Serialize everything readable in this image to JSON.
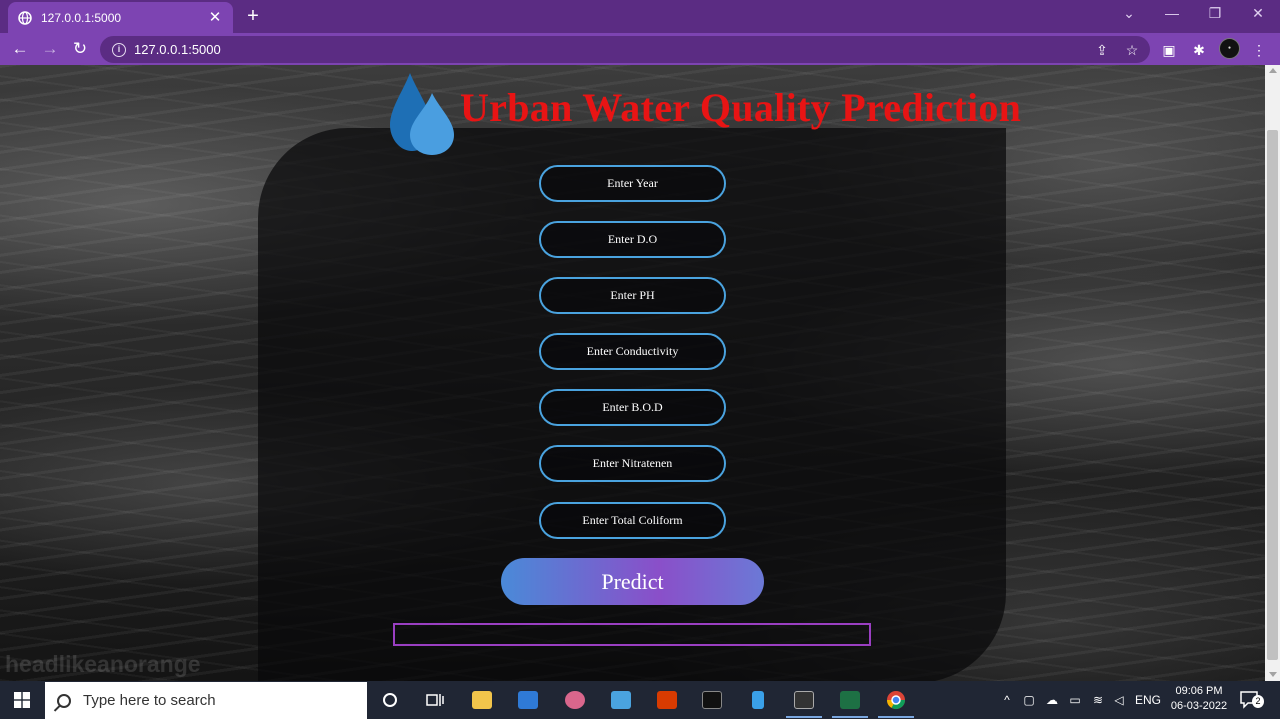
{
  "browser": {
    "tab_title": "127.0.0.1:5000",
    "tab_close": "✕",
    "new_tab": "+",
    "url": "127.0.0.1:5000"
  },
  "page": {
    "heading": "Urban Water Quality Prediction",
    "fields": [
      {
        "name": "year-input",
        "placeholder": "Enter Year"
      },
      {
        "name": "do-input",
        "placeholder": "Enter D.O"
      },
      {
        "name": "ph-input",
        "placeholder": "Enter PH"
      },
      {
        "name": "conductivity-input",
        "placeholder": "Enter Conductivity"
      },
      {
        "name": "bod-input",
        "placeholder": "Enter B.O.D"
      },
      {
        "name": "nitratenen-input",
        "placeholder": "Enter Nitratenen"
      },
      {
        "name": "total-coliform-input",
        "placeholder": "Enter Total Coliform"
      }
    ],
    "predict_label": "Predict",
    "result_text": "",
    "watermark": "headlikeanorange",
    "colors": {
      "heading": "#e81414",
      "field_border": "#4aa3df",
      "result_border": "#9a3fc2"
    }
  },
  "taskbar": {
    "search_placeholder": "Type here to search",
    "language": "ENG",
    "time": "09:06 PM",
    "date": "06-03-2022",
    "notification_count": "2"
  }
}
